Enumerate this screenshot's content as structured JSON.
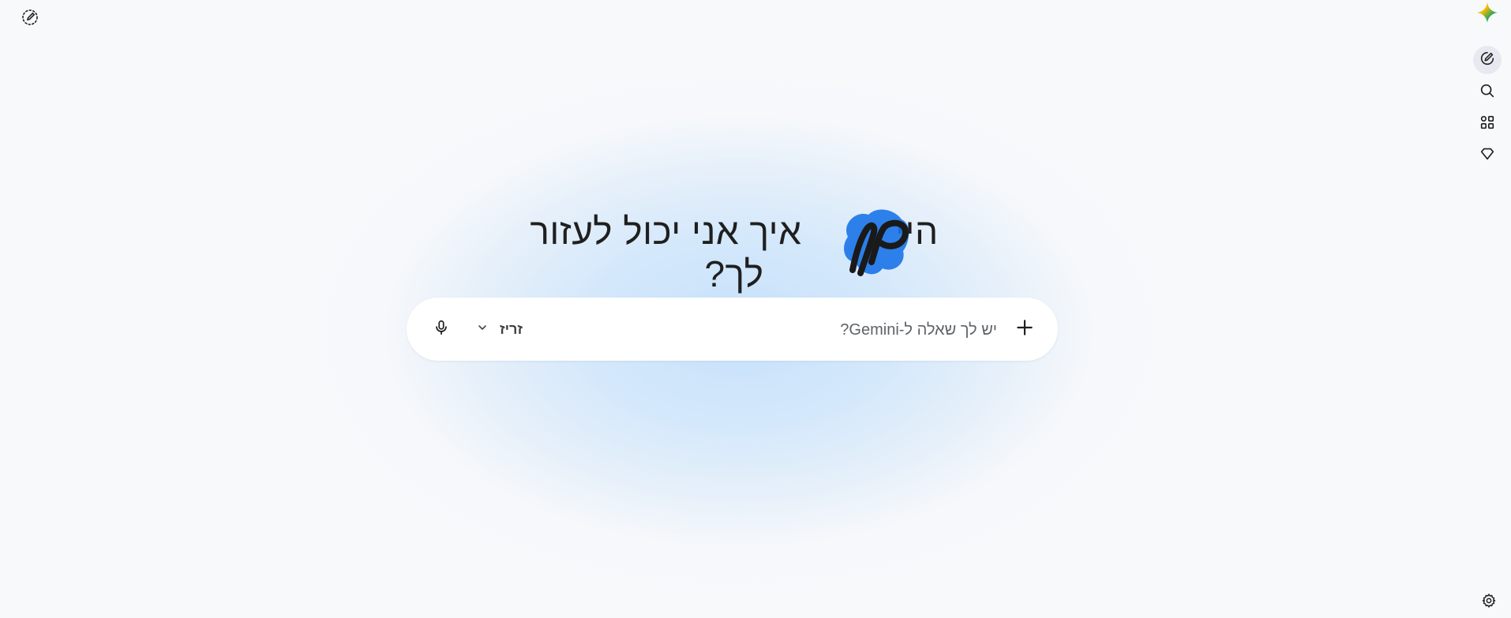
{
  "app": {
    "name": "Gemini",
    "accent_colors": [
      "#4285f4",
      "#ea4335",
      "#fbbc04",
      "#34a853"
    ]
  },
  "top_left": {
    "icon": "temporary-chat-icon"
  },
  "rail": {
    "logo_icon": "gemini-logo-icon",
    "items": [
      {
        "icon": "new-chat-icon",
        "active": true
      },
      {
        "icon": "search-icon",
        "active": false
      },
      {
        "icon": "apps-icon",
        "active": false
      },
      {
        "icon": "gem-icon",
        "active": false
      }
    ],
    "settings_icon": "gear-icon"
  },
  "greeting": {
    "prefix": "היי",
    "suffix": "איך אני יכול לעזור לך?"
  },
  "composer": {
    "placeholder": "יש לך שאלה ל-Gemini?",
    "value": "",
    "model_label": "זריז",
    "add_icon": "plus-icon",
    "mic_icon": "microphone-icon",
    "dropdown_icon": "chevron-down-icon"
  }
}
